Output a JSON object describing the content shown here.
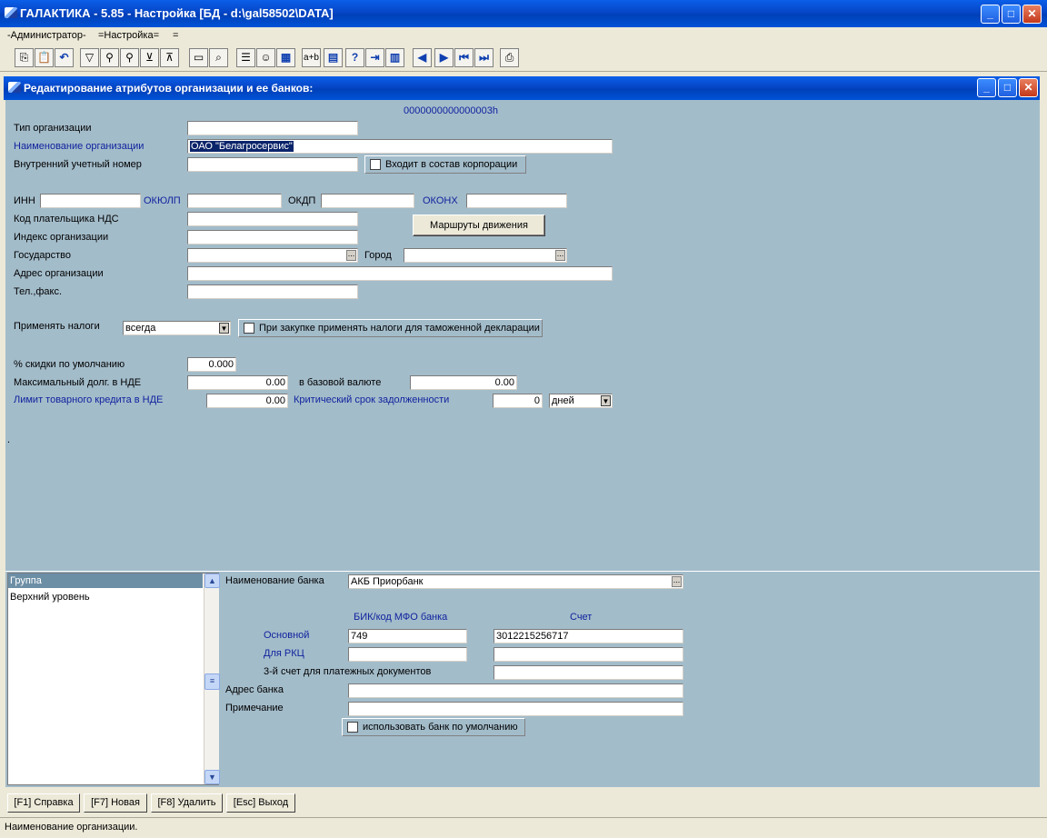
{
  "app": {
    "title": "ГАЛАКТИКА - 5.85 - Настройка [БД - d:\\gal58502\\DATA]",
    "menu": [
      "-Администратор-",
      "=Настройка=",
      "="
    ]
  },
  "toolbar_icons": [
    "copy-icon",
    "paste-icon",
    "undo-icon",
    "filter-icon",
    "find-icon",
    "find-next-icon",
    "filter-set-icon",
    "filter-clear-icon",
    "open-folder-icon",
    "search-folder-icon",
    "list-icon",
    "smiley-icon",
    "calculator-icon",
    "replace-icon",
    "keyboard-icon",
    "help-icon",
    "exit-icon",
    "grid-icon",
    "prev-icon",
    "next-icon",
    "first-icon",
    "last-icon",
    "print-icon"
  ],
  "dialog": {
    "title": "Редактирование атрибутов организации и ее банков:",
    "record_id": "0000000000000003h"
  },
  "form": {
    "org_type_label": "Тип организации",
    "org_type_value": "",
    "org_name_label": "Наименование организации",
    "org_name_value": "ОАО \"Белагросервис\"",
    "internal_num_label": "Внутренний учетный номер",
    "internal_num_value": "",
    "corp_checkbox": "Входит в состав корпорации",
    "inn_label": "ИНН",
    "okulp_label": "ОКЮЛП",
    "okdp_label": "ОКДП",
    "okonh_label": "ОКОНХ",
    "vat_code_label": "Код плательщика НДС",
    "index_label": "Индекс организации",
    "routes_button": "Маршруты движения",
    "country_label": "Государство",
    "city_label": "Город",
    "address_label": "Адрес организации",
    "phone_label": "Тел.,факс.",
    "taxes_label": "Применять налоги",
    "taxes_value": "всегда",
    "customs_checkbox": "При закупке применять налоги для таможенной декларации",
    "discount_label": "% скидки по умолчанию",
    "discount_value": "0.000",
    "max_debt_label": "Максимальный долг. в НДЕ",
    "max_debt_value": "0.00",
    "base_currency_label": "в базовой валюте",
    "base_currency_value": "0.00",
    "credit_limit_label": "Лимит товарного кредита в НДЕ",
    "credit_limit_value": "0.00",
    "critical_term_label": "Критический срок задолженности",
    "critical_term_value": "0",
    "critical_term_unit": "дней",
    "dot": "."
  },
  "groups": {
    "items": [
      "Группа",
      "Верхний уровень"
    ]
  },
  "bank": {
    "name_label": "Наименование банка",
    "name_value": "АКБ Приорбанк",
    "bik_header": "БИК/код МФО банка",
    "account_header": "Счет",
    "main_label": "Основной",
    "main_bik": "749",
    "main_account": "3012215256717",
    "rkc_label": "Для РКЦ",
    "third_account_label": "3-й счет для платежных документов",
    "address_label": "Адрес банка",
    "note_label": "Примечание",
    "default_checkbox": "использовать банк по умолчанию"
  },
  "fkeys": [
    "[F1] Справка",
    "[F7] Новая",
    "[F8] Удалить",
    "[Esc] Выход"
  ],
  "status": "Наименование организации."
}
